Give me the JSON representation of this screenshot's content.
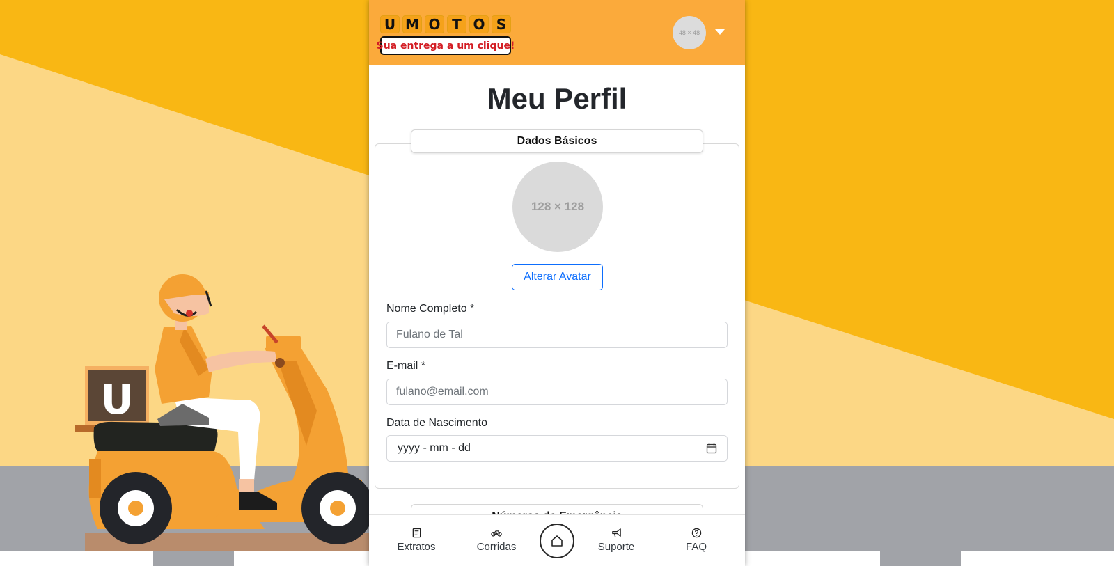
{
  "brand": {
    "letters": [
      "U",
      "M",
      "O",
      "T",
      "O",
      "S"
    ],
    "tagline": "Sua entrega a um clique!",
    "letter_color": "#f5a21a",
    "tagline_color": "#d31e25"
  },
  "header": {
    "avatar_placeholder": "48 × 48",
    "background": "#fbaa3b"
  },
  "page": {
    "title": "Meu Perfil"
  },
  "basic_data": {
    "section_title": "Dados Básicos",
    "avatar_placeholder": "128 × 128",
    "change_avatar_label": "Alterar Avatar",
    "fields": {
      "full_name": {
        "label": "Nome Completo *",
        "placeholder": "Fulano de Tal"
      },
      "email": {
        "label": "E-mail *",
        "placeholder": "fulano@email.com"
      },
      "birth_date": {
        "label": "Data de Nascimento",
        "placeholder": "yyyy - mm - dd"
      }
    }
  },
  "emergency": {
    "section_title": "Números de Emergência"
  },
  "bottom_nav": {
    "items": [
      {
        "label": "Extratos",
        "icon": "receipt-icon"
      },
      {
        "label": "Corridas",
        "icon": "bicycle-icon"
      },
      {
        "label": "",
        "icon": "home-icon"
      },
      {
        "label": "Suporte",
        "icon": "megaphone-icon"
      },
      {
        "label": "FAQ",
        "icon": "question-circle-icon"
      }
    ]
  },
  "colors": {
    "accent_blue": "#0d6efd",
    "background_yellow": "#f9b714",
    "background_light": "#fcd785"
  }
}
